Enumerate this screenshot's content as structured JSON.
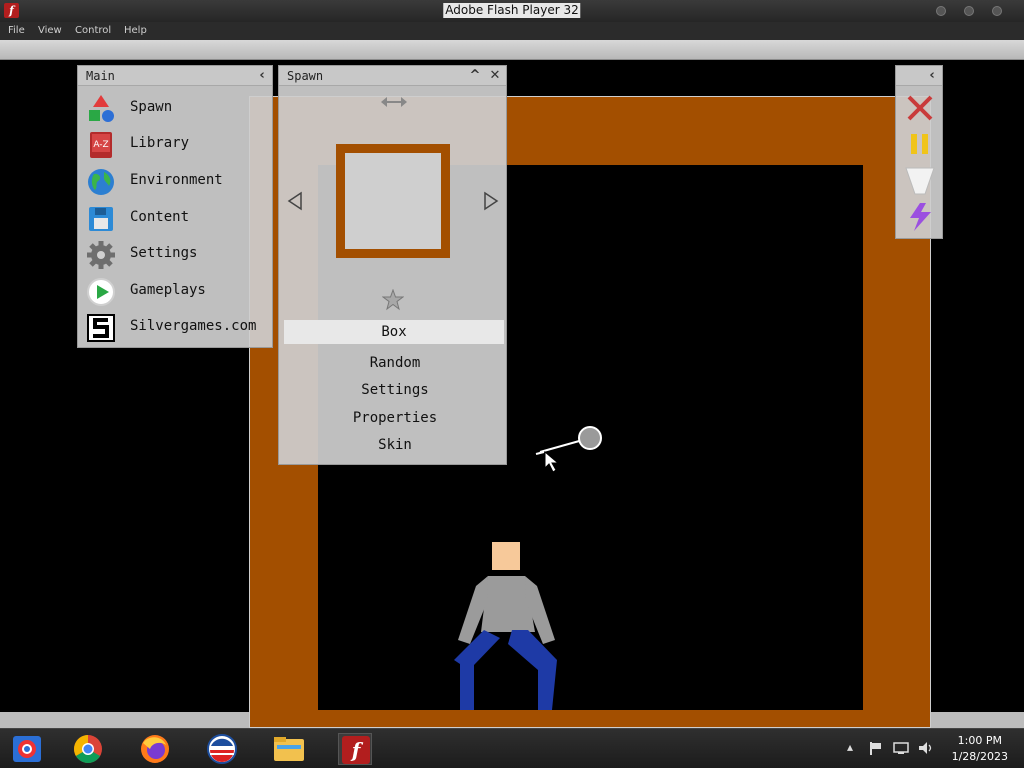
{
  "window": {
    "title": "Adobe Flash Player 32",
    "app_icon_glyph": "f"
  },
  "menu": {
    "items": [
      "File",
      "View",
      "Control",
      "Help"
    ]
  },
  "panels": {
    "main": {
      "title": "Main",
      "collapse_icon": "chevron-left-icon",
      "items": [
        {
          "label": "Spawn",
          "icon": "shapes-icon"
        },
        {
          "label": "Library",
          "icon": "book-icon"
        },
        {
          "label": "Environment",
          "icon": "globe-icon"
        },
        {
          "label": "Content",
          "icon": "floppy-icon"
        },
        {
          "label": "Settings",
          "icon": "gear-icon"
        },
        {
          "label": "Gameplays",
          "icon": "play-icon"
        },
        {
          "label": "Silvergames.com",
          "icon": "silvergames-logo-icon"
        }
      ]
    },
    "spawn": {
      "title": "Spawn",
      "selected_item": "Box",
      "options": [
        "Random",
        "Settings",
        "Properties",
        "Skin"
      ]
    },
    "tools": {
      "icons": [
        "close-icon",
        "pause-icon",
        "funnel-icon",
        "lightning-icon"
      ]
    }
  },
  "colors": {
    "box": "#a34f00",
    "ragdoll_skin": "#f7c99a",
    "ragdoll_shirt": "#9b9b9b",
    "ragdoll_pants": "#1e3aa6",
    "close_red": "#c93b3b",
    "pause_yellow": "#f0c419",
    "lightning_purple": "#9b4fe0"
  },
  "taskbar": {
    "apps": [
      "chrome-cube-icon",
      "chrome-icon",
      "firefox-icon",
      "obama-logo-icon",
      "file-explorer-icon",
      "flash-player-icon"
    ],
    "time": "1:00 PM",
    "date": "1/28/2023"
  }
}
